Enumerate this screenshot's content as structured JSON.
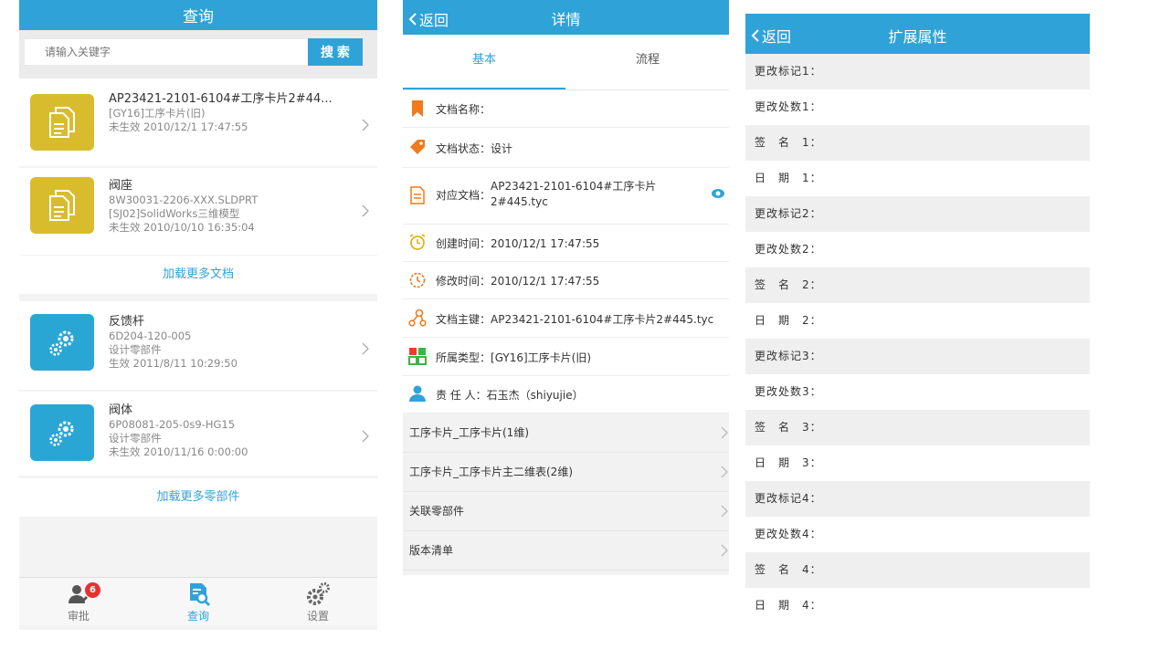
{
  "panel1": {
    "title": "查询",
    "search": {
      "placeholder": "请输入关键字",
      "button": "搜 索"
    },
    "documents": [
      {
        "t1": "AP23421-2101-6104#工序卡片2#44...",
        "t2": "[GY16]工序卡片(旧)",
        "t3": "未生效 2010/12/1 17:47:55"
      },
      {
        "t1": "阀座",
        "t2": "8W30031-2206-XXX.SLDPRT",
        "t3": "[SJ02]SolidWorks三维模型",
        "t4": "未生效 2010/10/10 16:35:04"
      }
    ],
    "load_more_docs": "加载更多文档",
    "parts": [
      {
        "t1": "反馈杆",
        "t2": "6D204-120-005",
        "t3": "设计零部件",
        "t4": "生效 2011/8/11 10:29:50"
      },
      {
        "t1": "阀体",
        "t2": "6P08081-205-0s9-HG15",
        "t3": "设计零部件",
        "t4": "未生效 2010/11/16 0:00:00"
      }
    ],
    "load_more_parts": "加载更多零部件",
    "tabbar": [
      {
        "label": "审批",
        "badge": "6"
      },
      {
        "label": "查询"
      },
      {
        "label": "设置"
      }
    ],
    "accent": "#2fa3d8"
  },
  "panel2": {
    "back": "返回",
    "title": "详情",
    "tabs": [
      "基本",
      "流程"
    ],
    "rows": [
      {
        "label": "文档名称：",
        "value": ""
      },
      {
        "label": "文档状态：",
        "value": "设计"
      },
      {
        "label": "对应文档：",
        "value": "AP23421-2101-6104#工序卡片2#445.tyc"
      },
      {
        "label": "创建时间：",
        "value": "2010/12/1 17:47:55"
      },
      {
        "label": "修改时间：",
        "value": "2010/12/1 17:47:55"
      },
      {
        "label": "文档主键：",
        "value": "AP23421-2101-6104#工序卡片2#445.tyc"
      },
      {
        "label": "所属类型：",
        "value": "[GY16]工序卡片(旧)"
      },
      {
        "label": "责 任 人：",
        "value": "石玉杰（shiyujie）"
      }
    ],
    "links": [
      "工序卡片_工序卡片(1维)",
      "工序卡片_工序卡片主二维表(2维)",
      "关联零部件",
      "版本清单"
    ]
  },
  "panel3": {
    "back": "返回",
    "title": "扩展属性",
    "rows": [
      "更改标记1：",
      "更改处数1：",
      "签　名　1：",
      "日　期　1：",
      "更改标记2：",
      "更改处数2：",
      "签　名　2：",
      "日　期　2：",
      "更改标记3：",
      "更改处数3：",
      "签　名　3：",
      "日　期　3：",
      "更改标记4：",
      "更改处数4：",
      "签　名　4：",
      "日　期　4："
    ]
  }
}
